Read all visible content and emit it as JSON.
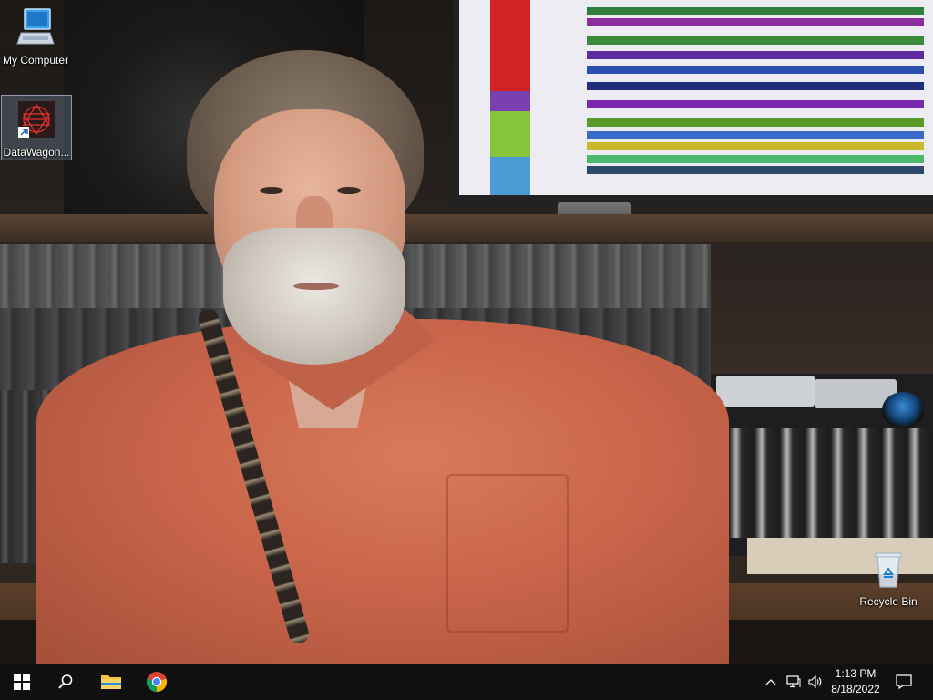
{
  "desktop": {
    "icons": [
      {
        "label": "My Computer",
        "icon": "computer-icon"
      },
      {
        "label": "DataWagon...",
        "icon": "datawagon-app-icon"
      },
      {
        "label": "Recycle Bin",
        "icon": "recycle-bin-icon"
      }
    ]
  },
  "taskbar": {
    "pinned": [
      {
        "name": "start",
        "icon": "windows-logo-icon"
      },
      {
        "name": "search",
        "icon": "search-icon"
      },
      {
        "name": "file-explorer",
        "icon": "folder-icon"
      },
      {
        "name": "chrome",
        "icon": "chrome-icon"
      }
    ],
    "tray": {
      "icons": [
        "chevron-up-icon",
        "network-icon",
        "volume-icon",
        "notification-icon"
      ],
      "time": "1:13 PM",
      "date": "8/18/2022"
    }
  },
  "colors": {
    "taskbar_bg": "#101010",
    "selection_bg": "#788caa",
    "accent": "#1e90ff"
  }
}
